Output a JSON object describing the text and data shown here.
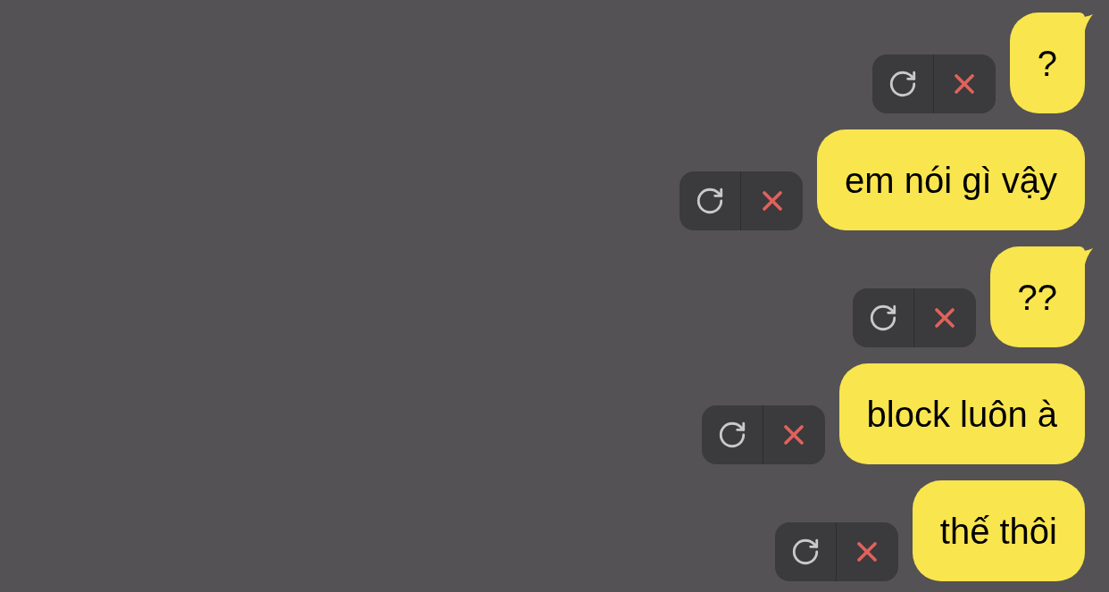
{
  "messages": [
    {
      "text": "?",
      "tail": true
    },
    {
      "text": "em nói gì vậy",
      "tail": false
    },
    {
      "text": "??",
      "tail": true
    },
    {
      "text": "block luôn à",
      "tail": false
    },
    {
      "text": "thế thôi",
      "tail": false
    }
  ]
}
